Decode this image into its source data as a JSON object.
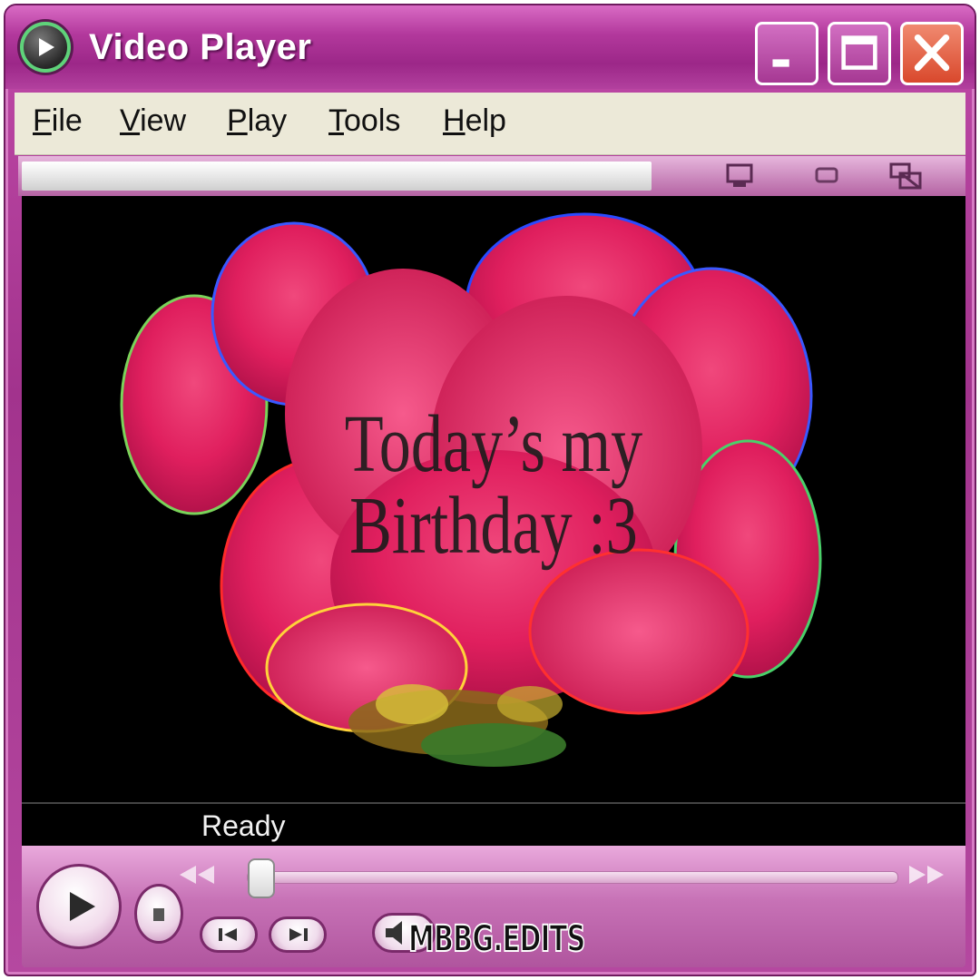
{
  "window": {
    "title": "Video Player",
    "icon": "media-player-icon",
    "buttons": [
      "minimize-icon",
      "maximize-icon",
      "close-icon"
    ]
  },
  "menu": {
    "items": [
      {
        "label_ul": "F",
        "label_rest": "ile"
      },
      {
        "label_ul": "V",
        "label_rest": "iew"
      },
      {
        "label_ul": "P",
        "label_rest": "lay"
      },
      {
        "label_ul": "T",
        "label_rest": "ools"
      },
      {
        "label_ul": "H",
        "label_rest": "elp"
      }
    ]
  },
  "toolbar": {
    "icons": [
      "skin-mode-icon",
      "compact-mode-icon",
      "fullscreen-icon"
    ]
  },
  "video": {
    "caption_line1": "Today’s my",
    "caption_line2": "Birthday :3"
  },
  "status": {
    "text": "Ready"
  },
  "controls": {
    "seek_position": 0.01,
    "watermark": "MBBG.EDITS"
  },
  "colors": {
    "frame": "#a2338d",
    "menu_bg": "#ece9d8",
    "video_bg": "#000000",
    "close_button": "#d9482c"
  }
}
